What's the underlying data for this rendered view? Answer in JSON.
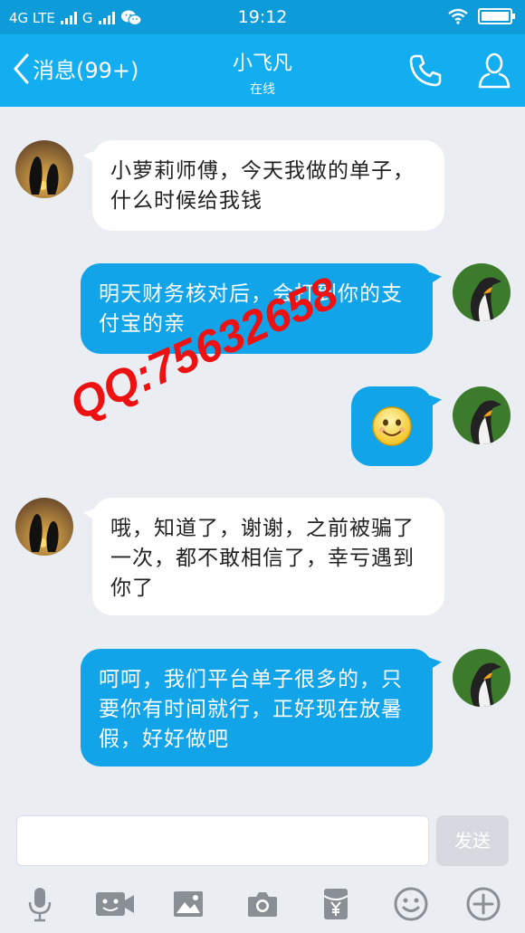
{
  "status_bar": {
    "network_left": "4G LTE",
    "network_right": "G",
    "time": "19:12"
  },
  "header": {
    "back_label": "消息(99+)",
    "contact_name": "小飞凡",
    "contact_status": "在线"
  },
  "messages": [
    {
      "side": "incoming",
      "text": "小萝莉师傅，今天我做的单子，什么时候给我钱"
    },
    {
      "side": "outgoing",
      "text": "明天财务核对后，会打到你的支付宝的亲"
    },
    {
      "side": "outgoing",
      "emoji": "smile-emoji"
    },
    {
      "side": "incoming",
      "text": "哦，知道了，谢谢，之前被骗了一次，都不敢相信了，幸亏遇到你了"
    },
    {
      "side": "outgoing",
      "text": "呵呵，我们平台单子很多的，只要你有时间就行，正好现在放暑假，好好做吧"
    }
  ],
  "watermark": "QQ:75632658",
  "input": {
    "value": "",
    "send_label": "发送"
  },
  "toolbar": [
    "microphone-icon",
    "video-icon",
    "image-icon",
    "camera-icon",
    "red-packet-icon",
    "emoji-icon",
    "plus-icon"
  ],
  "colors": {
    "header": "#12aef0",
    "status_bar": "#0d9bd9",
    "outgoing_bubble": "#12a4e8",
    "incoming_bubble": "#ffffff",
    "background": "#eaedf2",
    "watermark": "#ee1111"
  }
}
